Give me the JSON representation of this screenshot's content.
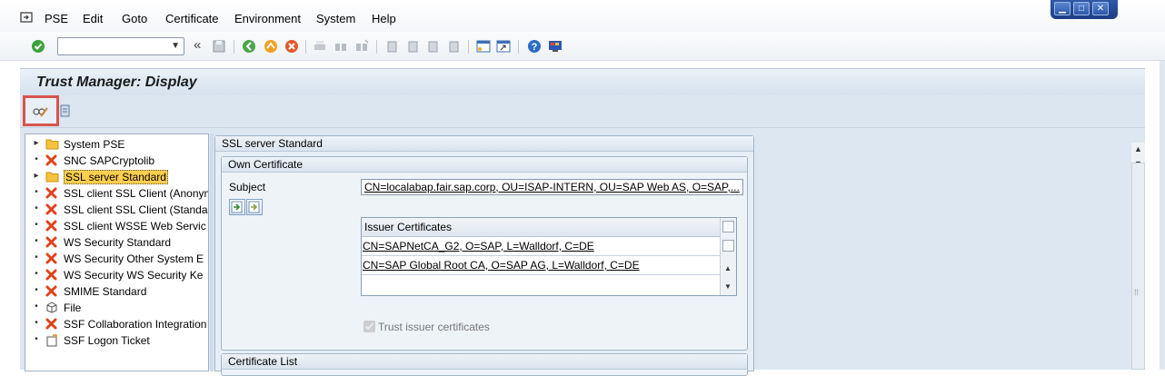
{
  "menubar": {
    "items": [
      "PSE",
      "Edit",
      "Goto",
      "Certificate",
      "Environment",
      "System",
      "Help"
    ],
    "window_controls": [
      "minimize-icon",
      "maximize-icon",
      "close-icon"
    ]
  },
  "toolbar": {
    "command_field": {
      "value": "",
      "placeholder": ""
    },
    "icons": [
      "enter-icon",
      "double-chevron-left-icon",
      "save-icon",
      "back-icon",
      "exit-icon",
      "cancel-icon",
      "print-icon",
      "find-icon",
      "find-next-icon",
      "first-page-icon",
      "previous-page-icon",
      "next-page-icon",
      "last-page-icon",
      "create-session-icon",
      "shortcut-icon",
      "help-icon",
      "customize-layout-icon"
    ]
  },
  "title": "Trust Manager: Display",
  "app_toolbar": {
    "change_button_icon": "display-change-icon",
    "other_button_icon": "pse-icon"
  },
  "tree": {
    "items": [
      {
        "label": "System PSE",
        "icon": "folder-icon",
        "expand": "triangle"
      },
      {
        "label": "SNC SAPCryptolib",
        "icon": "error-x-icon",
        "expand": "dot"
      },
      {
        "label": "SSL server Standard",
        "icon": "folder-icon",
        "expand": "triangle",
        "selected": true
      },
      {
        "label": "SSL client SSL Client (Anonym",
        "icon": "error-x-icon",
        "expand": "dot"
      },
      {
        "label": "SSL client SSL Client (Standa",
        "icon": "error-x-icon",
        "expand": "dot"
      },
      {
        "label": "SSL client WSSE Web Servic",
        "icon": "error-x-icon",
        "expand": "dot"
      },
      {
        "label": "WS Security Standard",
        "icon": "error-x-icon",
        "expand": "dot"
      },
      {
        "label": "WS Security Other System E",
        "icon": "error-x-icon",
        "expand": "dot"
      },
      {
        "label": "WS Security WS Security Ke",
        "icon": "error-x-icon",
        "expand": "dot"
      },
      {
        "label": "SMIME Standard",
        "icon": "error-x-icon",
        "expand": "dot"
      },
      {
        "label": "File",
        "icon": "box-icon",
        "expand": "dot"
      },
      {
        "label": "SSF Collaboration Integration",
        "icon": "error-x-icon",
        "expand": "dot"
      },
      {
        "label": "SSF Logon Ticket",
        "icon": "ticket-icon",
        "expand": "dot"
      }
    ]
  },
  "main": {
    "header": "SSL server Standard",
    "own_certificate": {
      "header": "Own Certificate",
      "subject_label": "Subject",
      "subject_value": "CN=localabap.fair.sap.corp, OU=ISAP-INTERN, OU=SAP Web AS, O=SAP,..."
    },
    "issuer_table": {
      "header": "Issuer Certificates",
      "rows": [
        "CN=SAPNetCA_G2, O=SAP, L=Walldorf, C=DE",
        "CN=SAP Global Root CA, O=SAP AG, L=Walldorf, C=DE"
      ]
    },
    "trust_issuer_label": "Trust issuer certificates",
    "trust_issuer_checked": true,
    "certificate_list_header": "Certificate List"
  }
}
